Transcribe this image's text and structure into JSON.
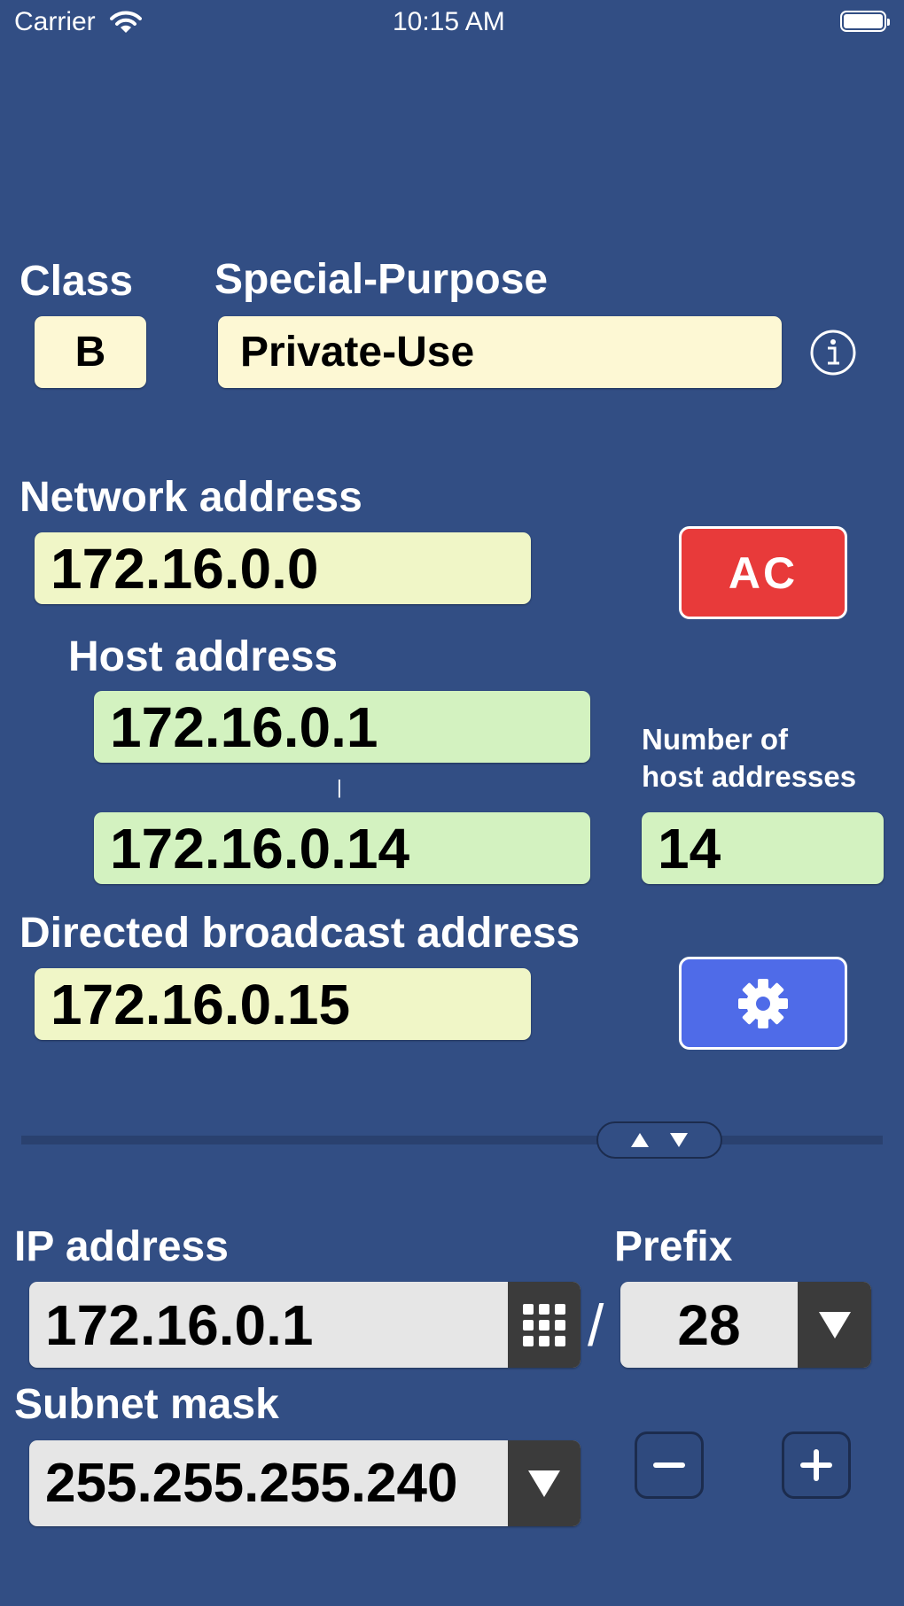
{
  "status_bar": {
    "carrier": "Carrier",
    "time": "10:15 AM"
  },
  "class_section": {
    "label": "Class",
    "value": "B"
  },
  "special_purpose": {
    "label": "Special-Purpose",
    "value": "Private-Use"
  },
  "network": {
    "label": "Network address",
    "value": "172.16.0.0"
  },
  "clear_button": {
    "label": "AC"
  },
  "host": {
    "label": "Host address",
    "first": "172.16.0.1",
    "last": "172.16.0.14",
    "range_separator": "|"
  },
  "host_count": {
    "label_line1": "Number of",
    "label_line2": "host addresses",
    "value": "14"
  },
  "broadcast": {
    "label": "Directed broadcast address",
    "value": "172.16.0.15"
  },
  "ip_address": {
    "label": "IP address",
    "value": "172.16.0.1"
  },
  "separator": "/",
  "prefix": {
    "label": "Prefix",
    "value": "28"
  },
  "subnet_mask": {
    "label": "Subnet mask",
    "value": "255.255.255.240"
  },
  "icons": {
    "wifi": "wifi-icon",
    "battery": "battery-icon",
    "info": "info-icon",
    "gear": "gear-icon",
    "keypad": "keypad-icon",
    "dropdown": "triangle-down-icon",
    "minus": "minus-icon",
    "plus": "plus-icon"
  },
  "colors": {
    "background": "#324e84",
    "clear_button": "#e83a3a",
    "settings_button": "#4f6be8",
    "cream_field": "#fdf8d4",
    "yellow_field": "#f0f6c7",
    "green_field": "#d3f2c0"
  }
}
